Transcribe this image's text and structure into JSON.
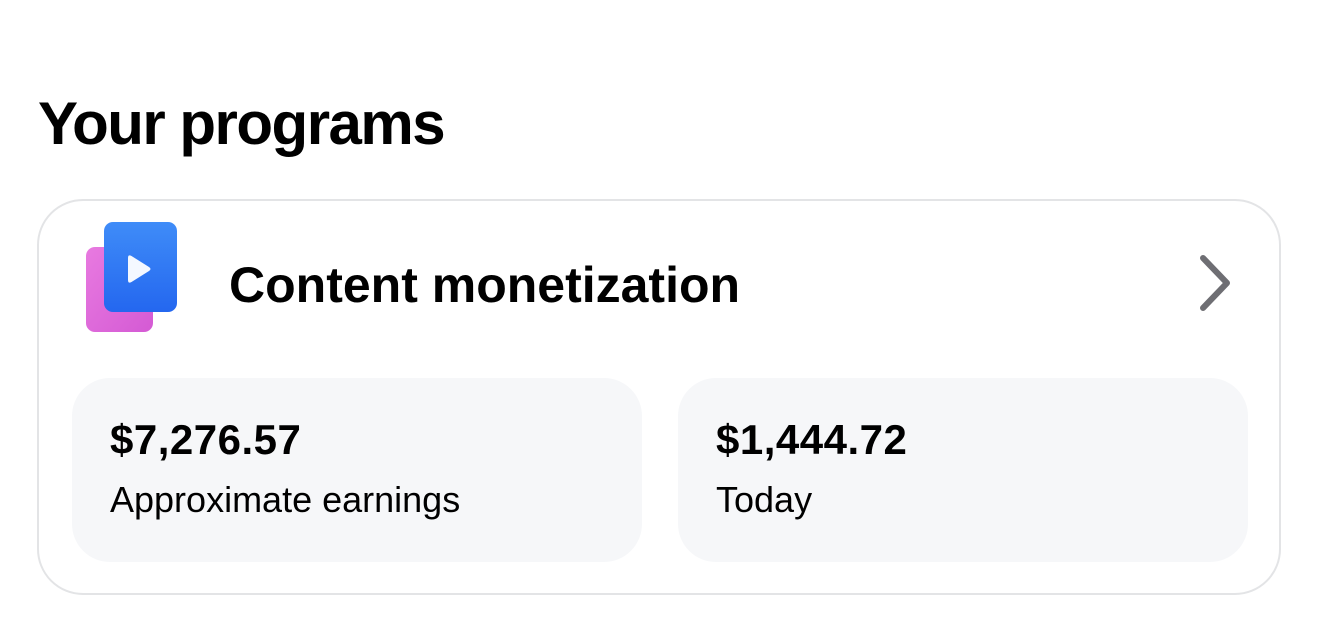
{
  "section": {
    "title": "Your programs"
  },
  "program": {
    "title": "Content monetization",
    "icon": "video-play-icon",
    "chevron_icon": "chevron-right-icon",
    "colors": {
      "icon_front": "#2f7bf5",
      "icon_back": "#e06bd8",
      "play": "#ffffff",
      "chevron": "#6e6e73"
    },
    "stats": [
      {
        "value": "$7,276.57",
        "label": "Approximate earnings"
      },
      {
        "value": "$1,444.72",
        "label": "Today"
      }
    ]
  }
}
